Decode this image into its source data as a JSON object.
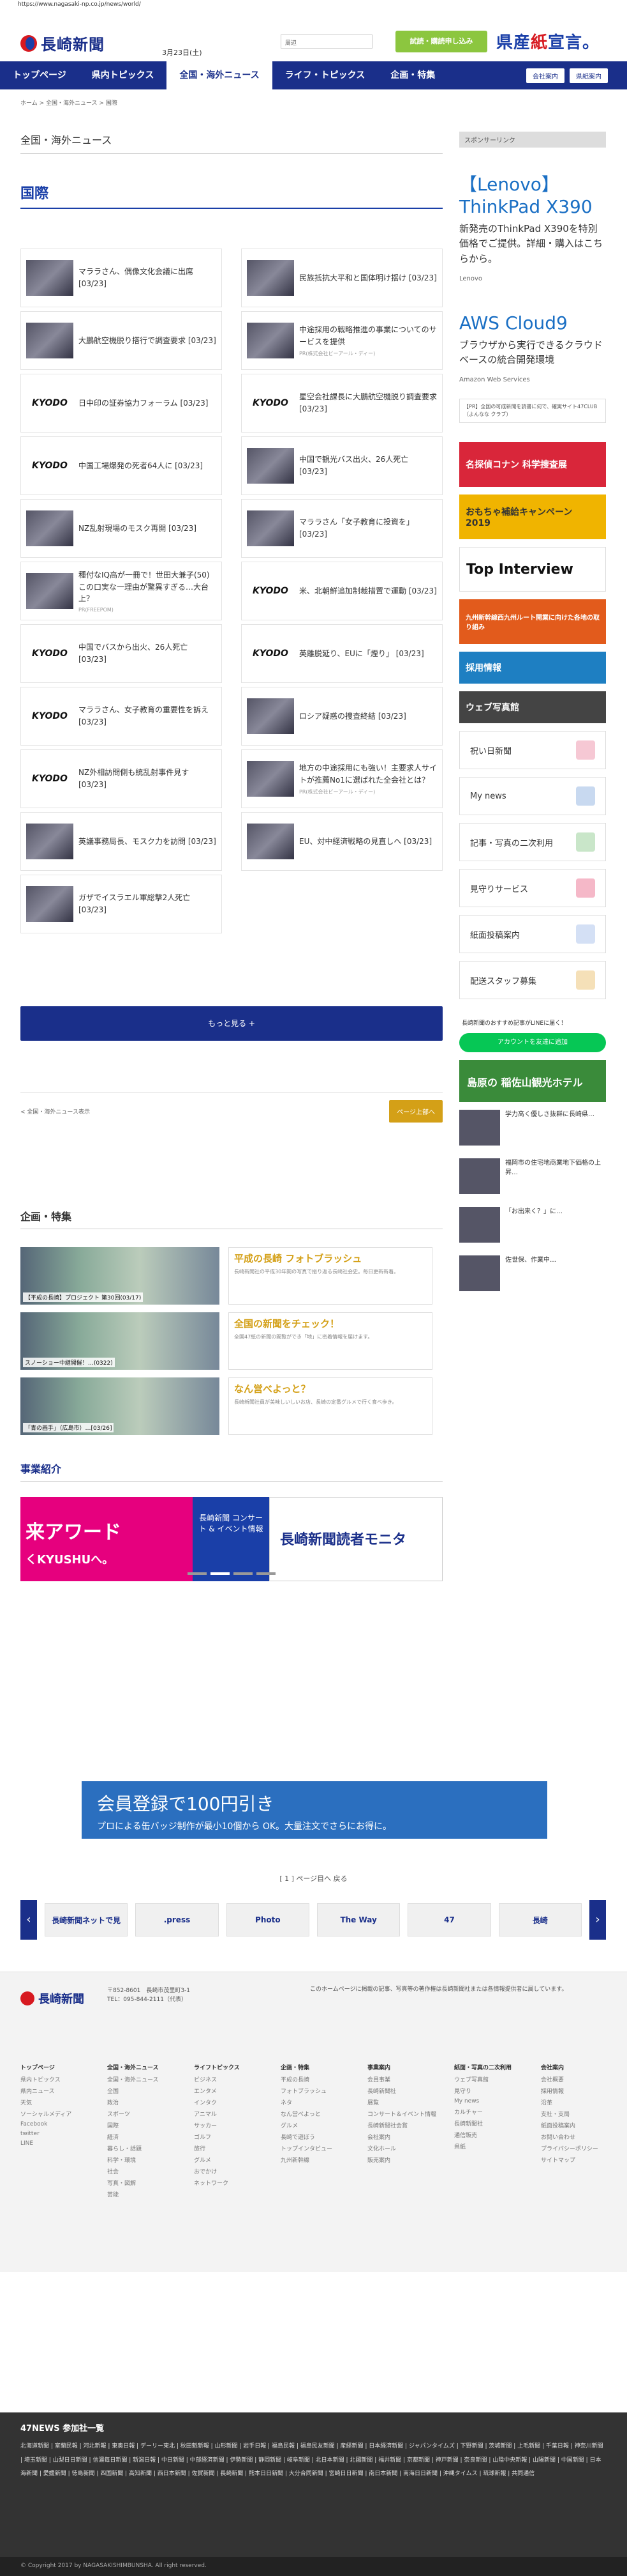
{
  "url": "https://www.nagasaki-np.co.jp/news/world/",
  "header": {
    "logo_text": "長崎新聞",
    "date": "3月23日(土)",
    "search_placeholder": "周辺",
    "trial_label": "試読・購読申し込み",
    "kenken_a": "県産",
    "kenken_b": "紙",
    "kenken_c": "宣言。"
  },
  "nav": {
    "items": [
      "トップページ",
      "県内トピックス",
      "全国・海外ニュース",
      "ライフ・トピックス",
      "企画・特集"
    ],
    "right": [
      "会社案内",
      "県紙案内"
    ]
  },
  "breadcrumb": "ホーム > 全国・海外ニュース > 国際",
  "main": {
    "section_title": "全国・海外ニュース",
    "category": "国際",
    "articles": [
      {
        "text": "マララさん、偶像文化会議に出席 [03/23]",
        "thumb": "photo"
      },
      {
        "text": "民族抵抗大平和と国体明け揺け [03/23]",
        "thumb": "photo"
      },
      {
        "text": "大鵬航空機脱り搭行で調査要求 [03/23]",
        "thumb": "photo"
      },
      {
        "text": "中途採用の戦略推進の事業についてのサービスを提供",
        "pr": "PR(株式会社ビーアール・ディー)",
        "thumb": "photo"
      },
      {
        "text": "日中印の証券協力フォーラム [03/23]",
        "thumb": "kyodo"
      },
      {
        "text": "星空会社課長に大鵬航空機脱り調査要求 [03/23]",
        "thumb": "kyodo"
      },
      {
        "text": "中国工場爆発の死者64人に [03/23]",
        "thumb": "kyodo"
      },
      {
        "text": "中国で観光バス出火、26人死亡 [03/23]",
        "thumb": "photo"
      },
      {
        "text": "NZ乱射現場のモスク再開 [03/23]",
        "thumb": "photo"
      },
      {
        "text": "マララさん「女子教育に投資を」 [03/23]",
        "thumb": "photo"
      },
      {
        "text": "種付なIQ高が一冊で！世田大兼子(50)この口実な一理由が驚異すぎる…大台上？",
        "pr": "PR(FREEPOM)",
        "thumb": "photo"
      },
      {
        "text": "米、北朝鮮追加制裁措置で運動 [03/23]",
        "thumb": "kyodo"
      },
      {
        "text": "中国でバスから出火、26人死亡 [03/23]",
        "thumb": "kyodo"
      },
      {
        "text": "英離脱延り、EUに「煙り」 [03/23]",
        "thumb": "kyodo"
      },
      {
        "text": "マララさん、女子教育の重要性を訴え [03/23]",
        "thumb": "kyodo"
      },
      {
        "text": "ロシア疑惑の捜査終結 [03/23]",
        "thumb": "photo"
      },
      {
        "text": "NZ外相訪問側も統乱射事件見す [03/23]",
        "thumb": "kyodo"
      },
      {
        "text": "地方の中途採用にも強い！主要求人サイトが推薦No1に選ばれた全会社とは？",
        "pr": "PR(株式会社ビーアール・ディー)",
        "thumb": "photo"
      },
      {
        "text": "英議事務局長、モスク力を訪問 [03/23]",
        "thumb": "photo"
      },
      {
        "text": "EU、対中経済戦略の見直しへ [03/23]",
        "thumb": "photo"
      },
      {
        "text": "ガザでイスラエル軍総撃2人死亡 [03/23]",
        "thumb": "photo"
      }
    ],
    "more_label": "もっと見る +",
    "pager_left": "< 全国・海外ニュース表示",
    "pager_right": "ページ上部へ"
  },
  "features": {
    "title": "企画・特集",
    "items": [
      {
        "caption": "【平成の長崎】プロジェクト 第30回(03/17)",
        "head": "平成の長崎 フォトブラッシュ",
        "desc": "長崎新聞社の平成30年間の写真で振り返る長崎社会史。毎日更新新着。"
      },
      {
        "caption": "スノーショー中継開催！…(0322)",
        "head": "全国の新聞をチェック！",
        "desc": "全国47紙の新聞の閲覧ができ「地」に密着情報を届けます。"
      },
      {
        "caption": "「青の画手」（広島市）…[03/26]",
        "head": "なん営べよっと？",
        "desc": "長崎新聞社員が美味しいしいお店、長崎の定番グルメで行く食べ歩き。"
      }
    ]
  },
  "jigyo": {
    "title": "事業紹介",
    "b1": "来アワード",
    "b1sub": "くKYUSHUへ。",
    "b2": "長崎新聞 コンサート & イベント情報",
    "b3": "長崎新聞読者モニタ"
  },
  "side": {
    "sponsor_label": "スポンサーリンク",
    "ad1_title": "【Lenovo】ThinkPad X390",
    "ad1_body": "新発売のThinkPad X390を特別価格でご提供。詳細・購入はこちらから。",
    "ad1_src": "Lenovo",
    "ad2_title": "AWS Cloud9",
    "ad2_body": "ブラウザから実行できるクラウドベースの統合開発環境",
    "ad2_src": "Amazon Web Services",
    "note": "【PR】全国の可成新聞を読書に何で、確実サイト47CLUB（よんなな クラブ）",
    "banners": [
      "名探偵コナン 科学捜査展",
      "おもちゃ補給キャンペーン 2019",
      "Top Interview",
      "九州新幹線西九州ルート開業に向けた各地の取り組み",
      "採用情報",
      "ウェブ写真館"
    ],
    "buttons": [
      "祝い日新聞",
      "My news",
      "記事・写真の二次利用",
      "見守りサービス",
      "紙面投稿案内",
      "配送スタッフ募集"
    ],
    "line_title": "長崎新聞のおすすめ記事がLINEに届く！",
    "line_btn": "アカウントを友達に追加",
    "kanko": "島原の 稲佐山観光ホテル",
    "news": [
      "学力高く優しさ抜群に長崎県…",
      "福岡市の住宅地商業地下価格の上昇…",
      "「お出来く？」に…",
      "佐世保、作業中…"
    ]
  },
  "bottom": {
    "ad_a": "会員登録で100円引き",
    "ad_b": "プロによる缶バッジ制作が最小10個から OK。大量注文でさらにお得に。",
    "slide_caption": "[ 1 ] ページ目へ 戻る",
    "logos": [
      "長崎新聞ネットで見",
      ".press",
      "Photo",
      "The Way",
      "47",
      "長崎"
    ]
  },
  "footer": {
    "logo": "長崎新聞",
    "addr1": "〒852-8601　長崎市茂里町3-1",
    "addr2": "TEL：095-844-2111（代表）",
    "note": "このホームページに掲載の記事、写真等の著作権は長崎新聞社または各情報提供者に属しています。",
    "cols": [
      {
        "h": "トップページ",
        "items": [
          "県内トピックス",
          "県内ニュース",
          "天気",
          "ソーシャルメディア",
          "Facebook",
          "twitter",
          "LINE"
        ]
      },
      {
        "h": "全国・海外ニュース",
        "items": [
          "全国・海外ニュース",
          "全国",
          "政治",
          "スポーツ",
          "国際",
          "経済",
          "暮らし・話題",
          "科学・環境",
          "社会",
          "写真・図解",
          "芸能"
        ]
      },
      {
        "h": "ライフトピックス",
        "items": [
          "ビジネス",
          "エンタメ",
          "インタク",
          "アニマル",
          "サッカー",
          "ゴルフ",
          "旅行",
          "グルメ",
          "おでかけ",
          "ネットワーク"
        ]
      },
      {
        "h": "企画・特集",
        "items": [
          "平成の長崎",
          "フォトブラッシュ",
          "ネタ",
          "なん営べよっと",
          "グルメ",
          "長崎で遊ぼう",
          "トップインタビュー",
          "九州新幹線"
        ]
      },
      {
        "h": "事業案内",
        "items": [
          "会員事業",
          "長崎新聞社",
          "展覧",
          "コンサート＆イベント情報",
          "長崎新聞社会賞",
          "会社案内",
          "文化ホール",
          "販売案内"
        ]
      },
      {
        "h": "紙面・写真の二次利用",
        "items": [
          "ウェブ写真館",
          "見守り",
          "My news",
          "カルチャー",
          "長崎新聞社",
          "通信販売",
          "県紙"
        ]
      },
      {
        "h": "会社案内",
        "items": [
          "会社概要",
          "採用情報",
          "沿革",
          "支社・支局",
          "紙面投稿案内",
          "お問い合わせ",
          "プライバシーポリシー",
          "サイトマップ"
        ]
      }
    ]
  },
  "forty7": {
    "title": "47NEWS 参加社一覧",
    "links": "北海道新聞 | 室蘭民報 | 河北新報 | 東奥日報 | デーリー東北 | 秋田魁新報 | 山形新聞 | 岩手日報 | 福島民報 | 福島民友新聞 | 産経新聞 | 日本経済新聞 | ジャパンタイムズ | 下野新聞 | 茨城新聞 | 上毛新聞 | 千葉日報 | 神奈川新聞 | 埼玉新聞 | 山梨日日新聞 | 信濃毎日新聞 | 新潟日報 | 中日新聞 | 中部経済新聞 | 伊勢新聞 | 静岡新聞 | 岐阜新聞 | 北日本新聞 | 北國新聞 | 福井新聞 | 京都新聞 | 神戸新聞 | 奈良新聞 | 山陰中央新報 | 山陽新聞 | 中国新聞 | 日本海新聞 | 愛媛新聞 | 徳島新聞 | 四国新聞 | 高知新聞 | 西日本新聞 | 佐賀新聞 | 長崎新聞 | 熊本日日新聞 | 大分合同新聞 | 宮崎日日新聞 | 南日本新聞 | 南海日日新聞 | 沖縄タイムス | 琉球新報 | 共同通信"
  },
  "copyright": "© Copyright 2017 by NAGASAKISHIMBUNSHA. All right reserved."
}
